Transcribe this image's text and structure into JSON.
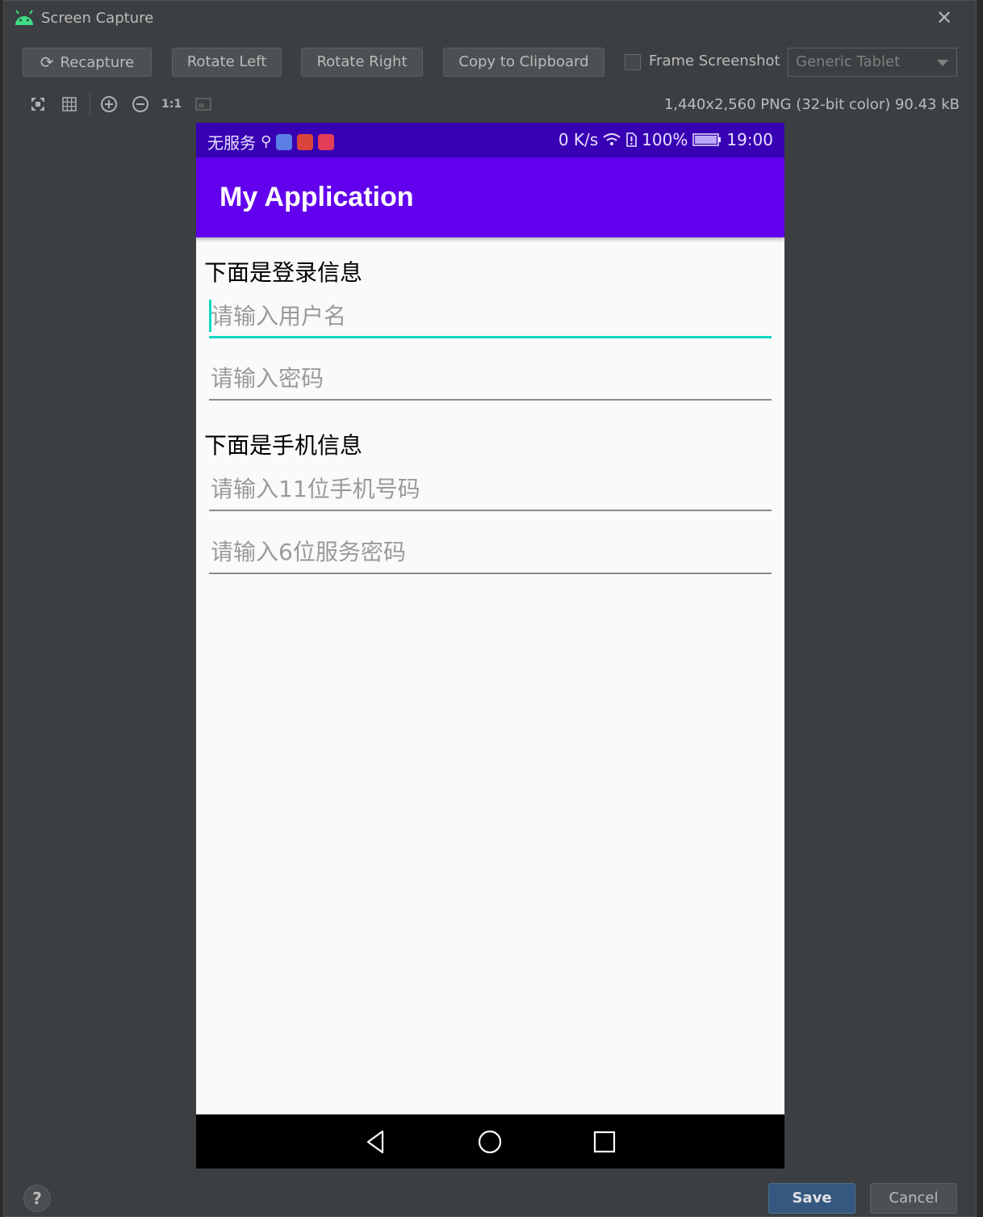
{
  "window": {
    "title": "Screen Capture"
  },
  "toolbar": {
    "recapture": "Recapture",
    "rotate_left": "Rotate Left",
    "rotate_right": "Rotate Right",
    "copy": "Copy to Clipboard",
    "frame_label": "Frame Screenshot",
    "frame_checked": false,
    "device": "Generic Tablet"
  },
  "zoom": {
    "icons": [
      "fit-screen-icon",
      "grid-icon",
      "zoom-in-icon",
      "zoom-out-icon",
      "actual-size-icon",
      "crop-icon"
    ],
    "actual_size_label": "1:1",
    "info": "1,440x2,560 PNG (32-bit color) 90.43 kB"
  },
  "phone": {
    "status": {
      "carrier": "无服务",
      "speed": "0 K/s",
      "battery": "100%",
      "time": "19:00"
    },
    "app_title": "My Application",
    "login_label": "下面是登录信息",
    "username_placeholder": "请输入用户名",
    "password_placeholder": "请输入密码",
    "phone_label": "下面是手机信息",
    "phone_placeholder": "请输入11位手机号码",
    "service_placeholder": "请输入6位服务密码",
    "colors": {
      "status_bar": "#3700b3",
      "app_bar": "#6200ee",
      "accent": "#03dac5"
    }
  },
  "footer": {
    "help": "?",
    "save": "Save",
    "cancel": "Cancel"
  }
}
